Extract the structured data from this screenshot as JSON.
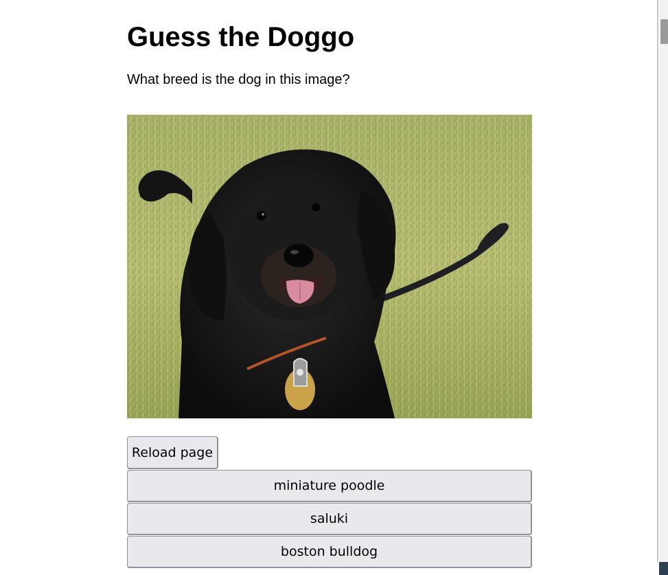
{
  "page": {
    "title": "Guess the Doggo",
    "question": "What breed is the dog in this image?"
  },
  "image": {
    "alt": "dog photo",
    "subject": "black curly-haired dog on grass with leash",
    "colors": {
      "grass_light": "#b9bf72",
      "grass_dark": "#7c8a3c",
      "fur": "#151515",
      "tongue": "#d98ba0",
      "collar": "#b2532a",
      "tag": "#c9a24a"
    }
  },
  "controls": {
    "reload_label": "Reload page"
  },
  "answers": [
    {
      "label": "miniature poodle"
    },
    {
      "label": "saluki"
    },
    {
      "label": "boston bulldog"
    }
  ],
  "colors": {
    "button_bg": "#e9e9ed",
    "button_border": "#8f8f9d"
  }
}
